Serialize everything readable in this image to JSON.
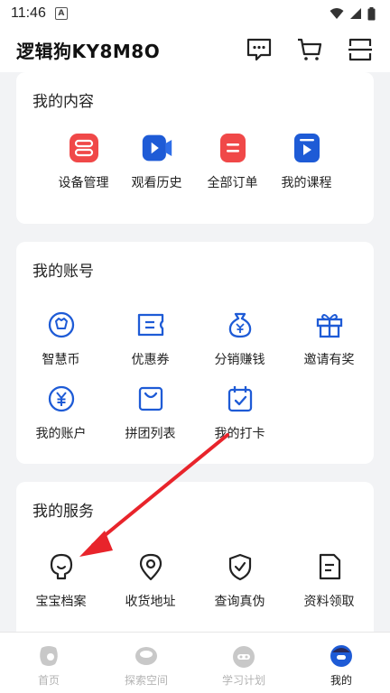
{
  "status_bar": {
    "time": "11:46",
    "badge": "A"
  },
  "header": {
    "title": "逻辑狗KY8M8O"
  },
  "my_content": {
    "title": "我的内容",
    "items": [
      {
        "label": "设备管理",
        "icon": "device-icon"
      },
      {
        "label": "观看历史",
        "icon": "video-icon"
      },
      {
        "label": "全部订单",
        "icon": "order-icon"
      },
      {
        "label": "我的课程",
        "icon": "course-icon"
      }
    ]
  },
  "my_account": {
    "title": "我的账号",
    "items": [
      {
        "label": "智慧币",
        "icon": "coin-icon"
      },
      {
        "label": "优惠券",
        "icon": "coupon-icon"
      },
      {
        "label": "分销赚钱",
        "icon": "money-bag-icon"
      },
      {
        "label": "邀请有奖",
        "icon": "gift-icon"
      },
      {
        "label": "我的账户",
        "icon": "yen-icon"
      },
      {
        "label": "拼团列表",
        "icon": "bag-icon"
      },
      {
        "label": "我的打卡",
        "icon": "calendar-check-icon"
      }
    ]
  },
  "my_services": {
    "title": "我的服务",
    "items": [
      {
        "label": "宝宝档案",
        "icon": "baby-icon"
      },
      {
        "label": "收货地址",
        "icon": "location-icon"
      },
      {
        "label": "查询真伪",
        "icon": "shield-check-icon"
      },
      {
        "label": "资料领取",
        "icon": "document-icon"
      }
    ]
  },
  "tabs": [
    {
      "label": "首页",
      "icon": "home-icon",
      "active": false
    },
    {
      "label": "探索空间",
      "icon": "explore-icon",
      "active": false
    },
    {
      "label": "学习计划",
      "icon": "plan-icon",
      "active": false
    },
    {
      "label": "我的",
      "icon": "profile-icon",
      "active": true
    }
  ],
  "colors": {
    "accent": "#1e5bd6",
    "red": "#f04848",
    "arrow": "#e8242b",
    "inactive": "#b3b3b3"
  }
}
